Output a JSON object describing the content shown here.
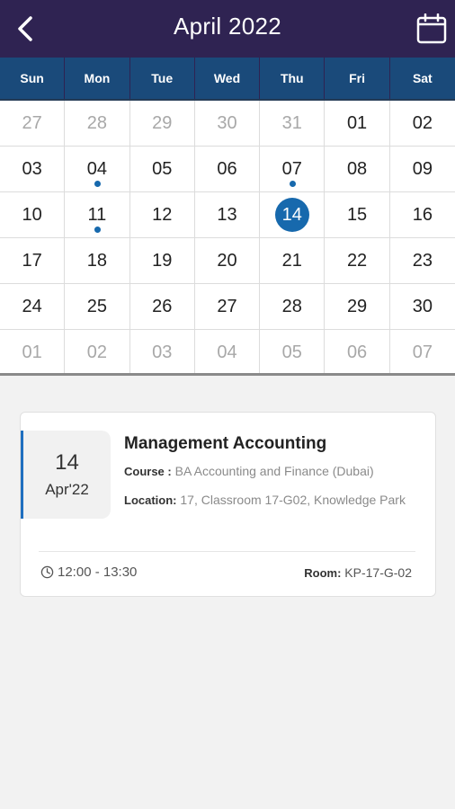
{
  "header": {
    "title": "April 2022",
    "back_icon": "back-arrow-icon",
    "calendar_icon": "calendar-icon"
  },
  "colors": {
    "header_bg": "#2f2352",
    "weekday_bg": "#1a4a7a",
    "accent": "#1769ad"
  },
  "calendar": {
    "weekdays": [
      "Sun",
      "Mon",
      "Tue",
      "Wed",
      "Thu",
      "Fri",
      "Sat"
    ],
    "days": [
      {
        "label": "27",
        "muted": true
      },
      {
        "label": "28",
        "muted": true
      },
      {
        "label": "29",
        "muted": true
      },
      {
        "label": "30",
        "muted": true
      },
      {
        "label": "31",
        "muted": true
      },
      {
        "label": "01"
      },
      {
        "label": "02"
      },
      {
        "label": "03"
      },
      {
        "label": "04",
        "event": true
      },
      {
        "label": "05"
      },
      {
        "label": "06"
      },
      {
        "label": "07",
        "event": true
      },
      {
        "label": "08"
      },
      {
        "label": "09"
      },
      {
        "label": "10"
      },
      {
        "label": "11",
        "event": true
      },
      {
        "label": "12"
      },
      {
        "label": "13"
      },
      {
        "label": "14",
        "selected": true
      },
      {
        "label": "15"
      },
      {
        "label": "16"
      },
      {
        "label": "17"
      },
      {
        "label": "18"
      },
      {
        "label": "19"
      },
      {
        "label": "20"
      },
      {
        "label": "21"
      },
      {
        "label": "22"
      },
      {
        "label": "23"
      },
      {
        "label": "24"
      },
      {
        "label": "25"
      },
      {
        "label": "26"
      },
      {
        "label": "27"
      },
      {
        "label": "28"
      },
      {
        "label": "29"
      },
      {
        "label": "30"
      },
      {
        "label": "01",
        "muted": true
      },
      {
        "label": "02",
        "muted": true
      },
      {
        "label": "03",
        "muted": true
      },
      {
        "label": "04",
        "muted": true
      },
      {
        "label": "05",
        "muted": true
      },
      {
        "label": "06",
        "muted": true
      },
      {
        "label": "07",
        "muted": true
      }
    ]
  },
  "event": {
    "day": "14",
    "month": "Apr'22",
    "title": "Management Accounting",
    "course_label": "Course :",
    "course": "BA Accounting and Finance (Dubai)",
    "location_label": "Location:",
    "location": "17, Classroom 17-G02, Knowledge Park",
    "time": "12:00 - 13:30",
    "time_icon": "clock-icon",
    "room_label": "Room:",
    "room": "KP-17-G-02"
  }
}
